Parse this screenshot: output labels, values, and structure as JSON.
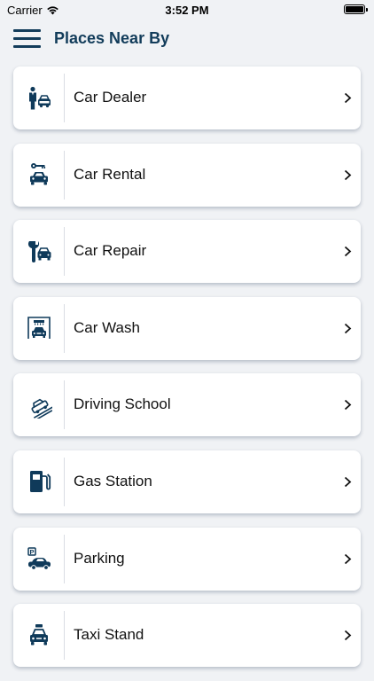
{
  "status_bar": {
    "carrier": "Carrier",
    "time": "3:52 PM",
    "battery_level": 1.0
  },
  "header": {
    "title": "Places Near By",
    "menu_icon": "hamburger-menu-icon"
  },
  "colors": {
    "accent": "#123c5a",
    "icon": "#0f3a5a",
    "background": "#f0f2f5",
    "card": "#ffffff"
  },
  "places": [
    {
      "label": "Car Dealer",
      "icon": "car-dealer-icon"
    },
    {
      "label": "Car Rental",
      "icon": "car-rental-icon"
    },
    {
      "label": "Car Repair",
      "icon": "car-repair-icon"
    },
    {
      "label": "Car Wash",
      "icon": "car-wash-icon"
    },
    {
      "label": "Driving School",
      "icon": "driving-school-icon"
    },
    {
      "label": "Gas Station",
      "icon": "gas-station-icon"
    },
    {
      "label": "Parking",
      "icon": "parking-icon"
    },
    {
      "label": "Taxi Stand",
      "icon": "taxi-stand-icon"
    }
  ]
}
